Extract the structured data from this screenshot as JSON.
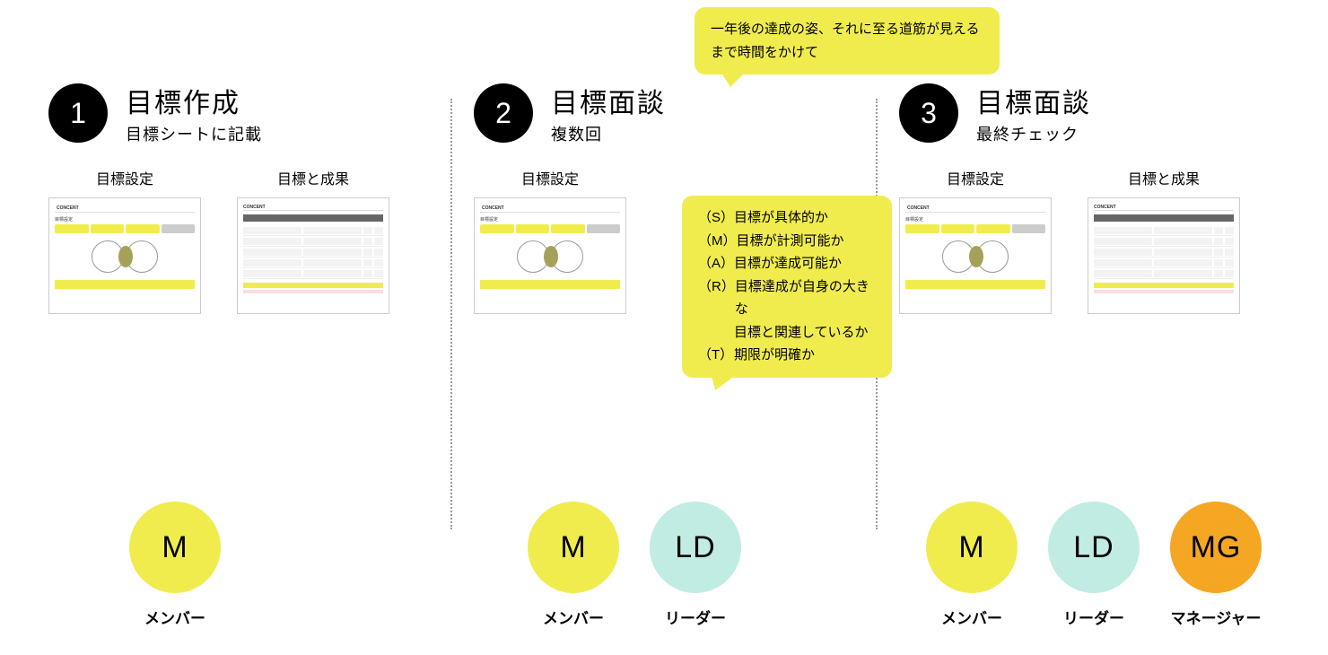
{
  "callouts": {
    "top": "一年後の達成の姿、それに至る道筋が見えるまで時間をかけて",
    "smart": {
      "s": {
        "k": "（S）",
        "v": "目標が具体的か"
      },
      "m": {
        "k": "（M）",
        "v": "目標が計測可能か"
      },
      "a": {
        "k": "（A）",
        "v": "目標が達成可能か"
      },
      "r": {
        "k": "（R）",
        "v": "目標達成が自身の大きな"
      },
      "r2": "目標と関連しているか",
      "t": {
        "k": "（T）",
        "v": "期限が明確か"
      }
    }
  },
  "thumb_labels": {
    "goal_setting": "目標設定",
    "goal_results": "目標と成果",
    "brand": "CONCENT"
  },
  "steps": [
    {
      "num": "1",
      "title": "目標作成",
      "sub": "目標シートに記載",
      "thumbs": [
        "goal_setting",
        "goal_results"
      ],
      "roles": [
        "m"
      ]
    },
    {
      "num": "2",
      "title": "目標面談",
      "sub": "複数回",
      "thumbs": [
        "goal_setting"
      ],
      "roles": [
        "m",
        "ld"
      ]
    },
    {
      "num": "3",
      "title": "目標面談",
      "sub": "最終チェック",
      "thumbs": [
        "goal_setting",
        "goal_results"
      ],
      "roles": [
        "m",
        "ld",
        "mg"
      ]
    }
  ],
  "roles": {
    "m": {
      "abbr": "M",
      "label": "メンバー"
    },
    "ld": {
      "abbr": "LD",
      "label": "リーダー"
    },
    "mg": {
      "abbr": "MG",
      "label": "マネージャー"
    }
  }
}
